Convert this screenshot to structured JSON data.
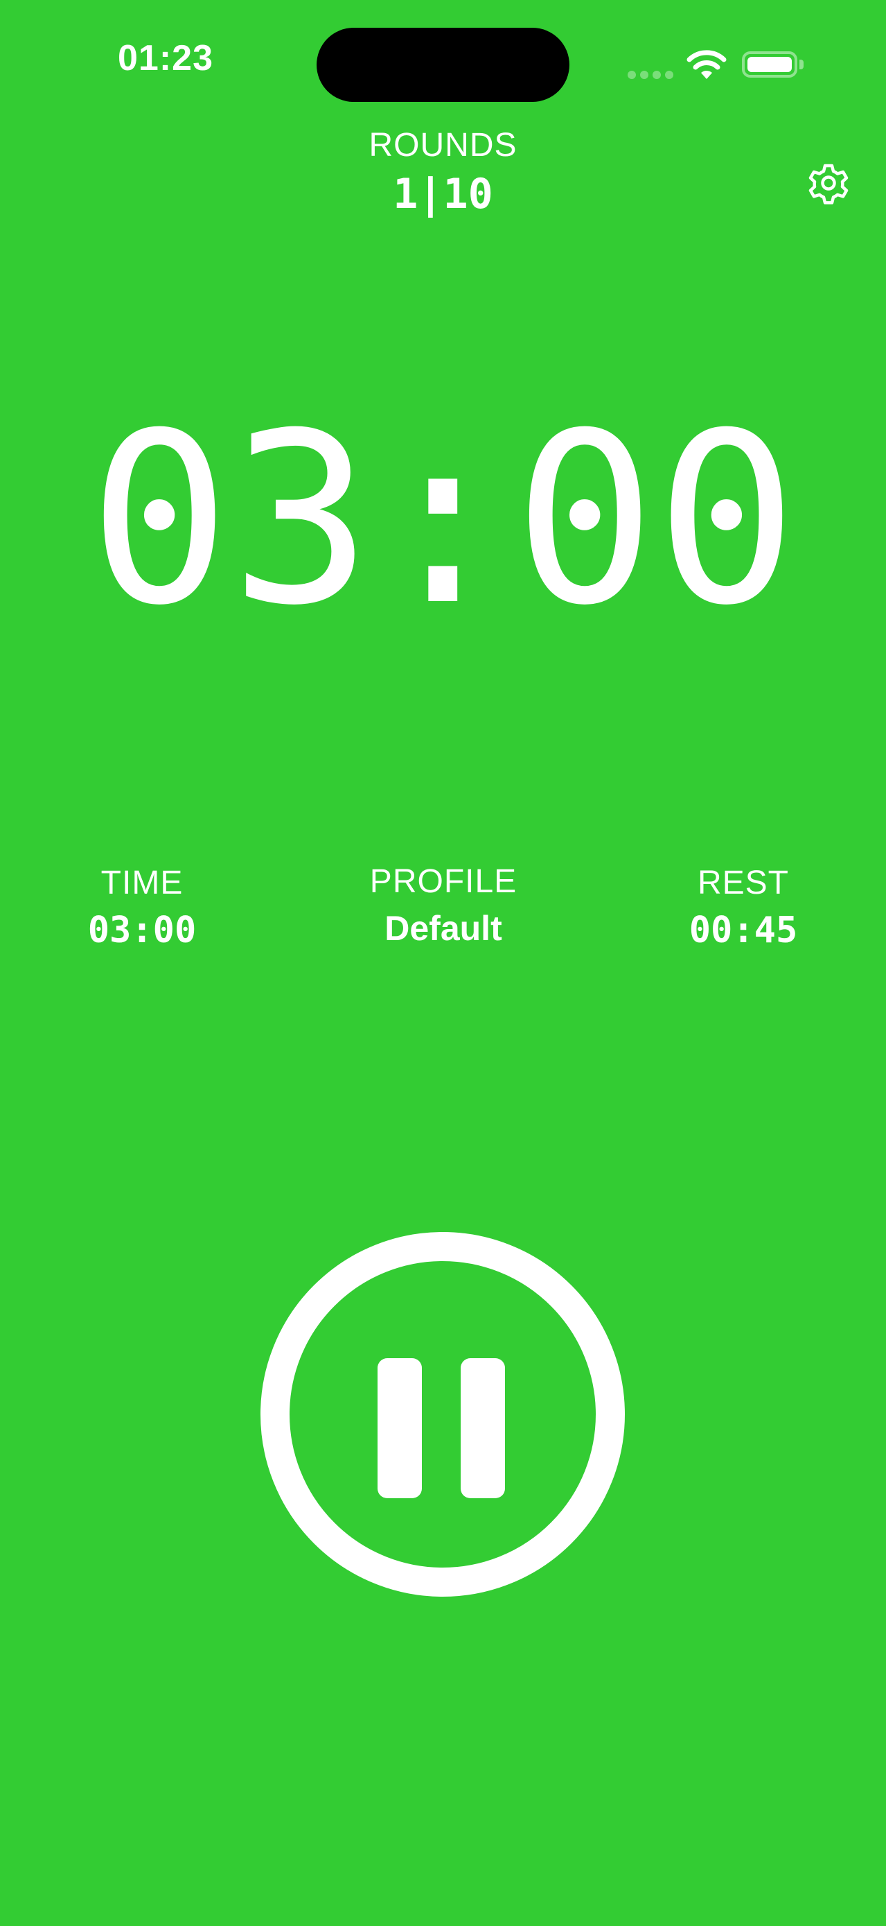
{
  "status_bar": {
    "time": "01:23",
    "icons": [
      "cellular-signal-icon",
      "wifi-icon",
      "battery-icon"
    ]
  },
  "rounds": {
    "label": "ROUNDS",
    "value": "1|10"
  },
  "header": {
    "settings_icon": "gear-icon"
  },
  "timer": {
    "display": "03:00"
  },
  "info": {
    "time_label": "TIME",
    "time_value": "03:00",
    "profile_label": "PROFILE",
    "profile_value": "Default",
    "rest_label": "REST",
    "rest_value": "00:45"
  },
  "controls": {
    "pause_icon": "pause-icon"
  },
  "colors": {
    "background": "#33CC33",
    "foreground": "#FFFFFF"
  }
}
